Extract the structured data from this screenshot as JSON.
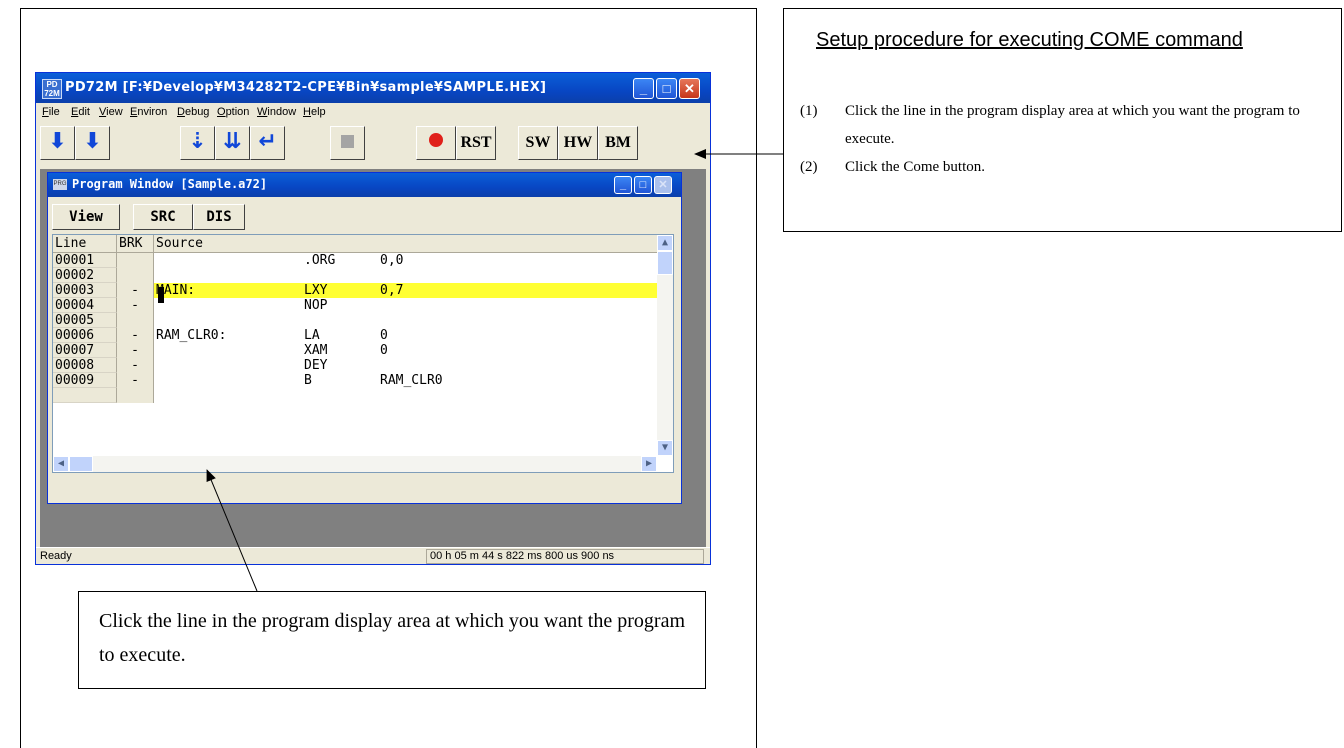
{
  "app": {
    "title": "PD72M [F:¥Develop¥M34282T2-CPE¥Bin¥sample¥SAMPLE.HEX]",
    "icon_text": "PD 72M",
    "caption_buttons": [
      "_",
      "□",
      "✕"
    ],
    "menu": [
      {
        "label": "File"
      },
      {
        "label": "Edit"
      },
      {
        "label": "View"
      },
      {
        "label": "Environ"
      },
      {
        "label": "Debug"
      },
      {
        "label": "Option"
      },
      {
        "label": "Window"
      },
      {
        "label": "Help"
      }
    ],
    "toolbar": {
      "go_free": "⬇",
      "go_break": "⬇",
      "step": "⇣",
      "over": "⇊",
      "return": "↵",
      "stop": "",
      "come": "",
      "reset": "RST",
      "sw": "SW",
      "hw": "HW",
      "bm": "BM"
    },
    "status": {
      "left": "Ready",
      "time": "00 h 05 m 44 s 822 ms 800 us 900 ns"
    }
  },
  "program_window": {
    "title": "Program Window [Sample.a72]",
    "icon_text": "PRG",
    "buttons": {
      "view": "View",
      "src": "SRC",
      "dis": "DIS"
    },
    "columns": [
      "Line",
      "BRK",
      "Source"
    ],
    "rows": [
      {
        "line": "00001",
        "brk": "",
        "label": "",
        "op": ".ORG",
        "arg": "0,0"
      },
      {
        "line": "00002",
        "brk": "",
        "label": "",
        "op": "",
        "arg": ""
      },
      {
        "line": "00003",
        "brk": "-",
        "label": "MAIN:",
        "op": "LXY",
        "arg": "0,7",
        "highlight": true
      },
      {
        "line": "00004",
        "brk": "-",
        "label": "",
        "op": "NOP",
        "arg": ""
      },
      {
        "line": "00005",
        "brk": "",
        "label": "",
        "op": "",
        "arg": ""
      },
      {
        "line": "00006",
        "brk": "-",
        "label": "RAM_CLR0:",
        "op": "LA",
        "arg": "0"
      },
      {
        "line": "00007",
        "brk": "-",
        "label": "",
        "op": "XAM",
        "arg": "0"
      },
      {
        "line": "00008",
        "brk": "-",
        "label": "",
        "op": "DEY",
        "arg": ""
      },
      {
        "line": "00009",
        "brk": "-",
        "label": "",
        "op": "B",
        "arg": "RAM_CLR0"
      }
    ],
    "highlight_color": "#ffff33"
  },
  "callout": {
    "text": "Click the line in the program display area at which you want the program to execute."
  },
  "instructions": {
    "title": "Setup procedure for executing COME command",
    "steps": [
      {
        "num": "(1)",
        "text": "Click the line in the program display area at which you want the program to execute."
      },
      {
        "num": "(2)",
        "text": "Click the Come button."
      }
    ]
  },
  "colors": {
    "titlebar": "#0846c3",
    "window_face": "#ece9d8",
    "workspace": "#808080",
    "arrow_icon": "#1147d8",
    "come_icon": "#e0201a"
  }
}
